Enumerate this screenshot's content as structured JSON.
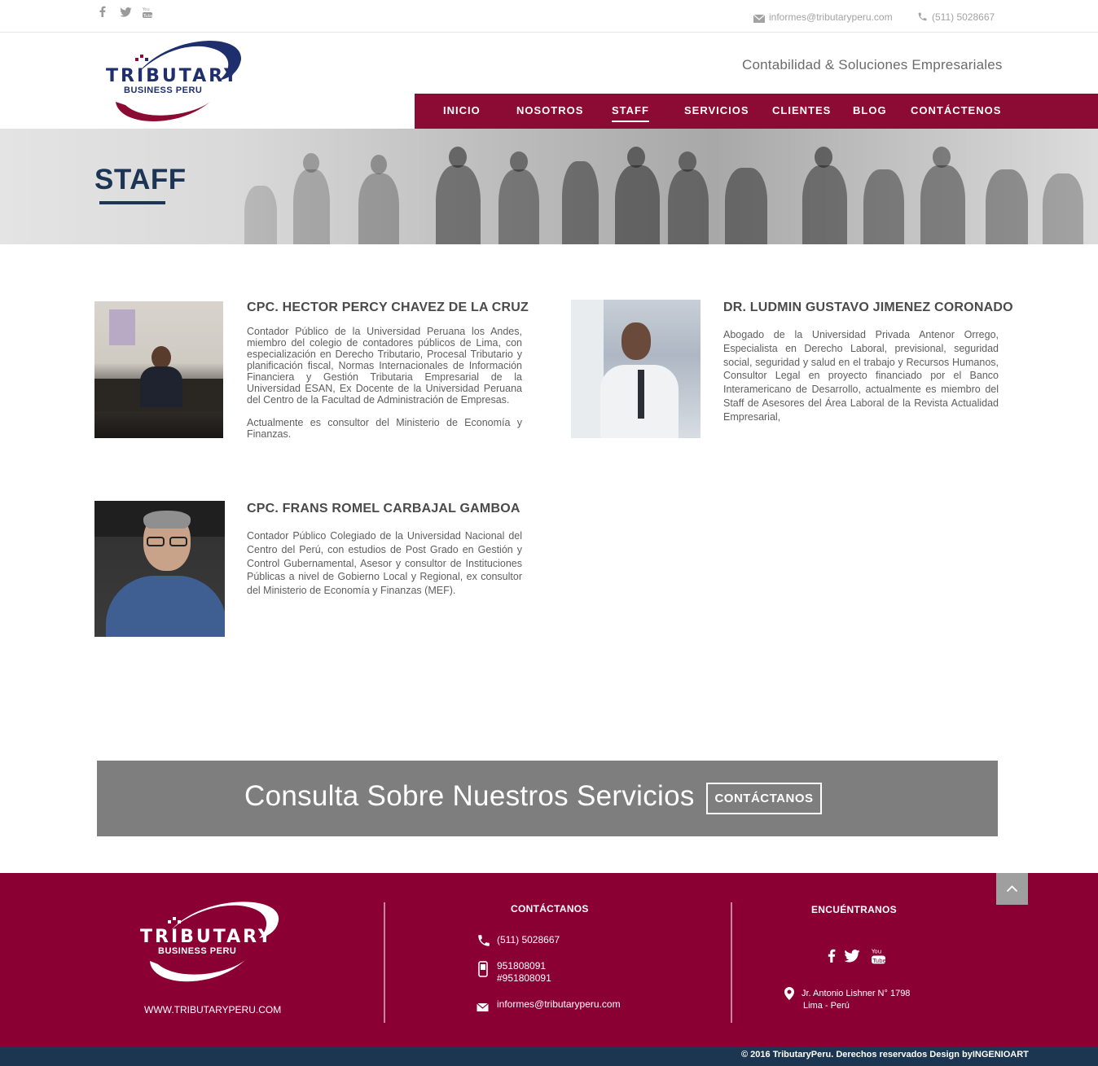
{
  "topbar": {
    "email": "informes@tributaryperu.com",
    "phone": "(511) 5028667"
  },
  "header": {
    "logo_main": "TRIBUTARY",
    "logo_sub": "BUSINESS PERU",
    "tagline": "Contabilidad & Soluciones Empresariales"
  },
  "nav": {
    "items": [
      "INICIO",
      "NOSOTROS",
      "STAFF",
      "SERVICIOS",
      "CLIENTES",
      "BLOG",
      "CONTÁCTENOS"
    ]
  },
  "hero": {
    "title": "STAFF"
  },
  "staff": [
    {
      "name": "CPC. HECTOR PERCY CHAVEZ DE LA CRUZ",
      "bio1": "Contador Público de la Universidad Peruana los Andes, miembro del colegio de contadores públicos de Lima, con especialización en Derecho Tributario, Procesal Tributario y planificación fiscal, Normas Internacionales de Información Financiera y Gestión Tributaria Empresarial de la Universidad ESAN, Ex Docente de la Universidad Peruana del Centro de la Facultad de Administración de Empresas.",
      "bio2": "Actualmente es consultor del Ministerio de Economía y Finanzas."
    },
    {
      "name": "DR. LUDMIN GUSTAVO JIMENEZ CORONADO",
      "bio1": "Abogado de la Universidad Privada Antenor Orrego, Especialista en Derecho Laboral, previsional, seguridad social, seguridad y salud en el trabajo y Recursos Humanos, Consultor Legal en proyecto financiado por el Banco Interamericano de Desarrollo, actualmente es miembro del Staff de Asesores del Área Laboral de la Revista Actualidad Empresarial,"
    },
    {
      "name": "CPC. FRANS ROMEL CARBAJAL GAMBOA",
      "bio1": "Contador Público Colegiado de la Universidad Nacional del Centro del Perú, con estudios de Post Grado en Gestión y Control Gubernamental, Asesor y consultor de Instituciones Públicas a nivel de Gobierno Local y Regional, ex consultor del Ministerio de Economía y Finanzas (MEF)."
    }
  ],
  "cta": {
    "text": "Consulta Sobre Nuestros Servicios",
    "button": "CONTÁCTANOS"
  },
  "footer": {
    "logo_main": "TRIBUTARY",
    "logo_sub": "BUSINESS PERU",
    "website": "WWW.TRIBUTARYPERU.COM",
    "contact_heading": "CONTÁCTANOS",
    "phone": "(511) 5028667",
    "mobile1": "951808091",
    "mobile2": "#951808091",
    "email": "informes@tributaryperu.com",
    "find_heading": "ENCUÉNTRANOS",
    "address1": "Jr. Antonio Lishner N° 1798",
    "address2": "Lima - Perú",
    "copyright": "© 2016  TributaryPeru. Derechos reservados Design byINGENIOART"
  },
  "colors": {
    "brand": "#8b0033",
    "navy": "#1d3554",
    "cta_gray": "#7e7e7e"
  }
}
